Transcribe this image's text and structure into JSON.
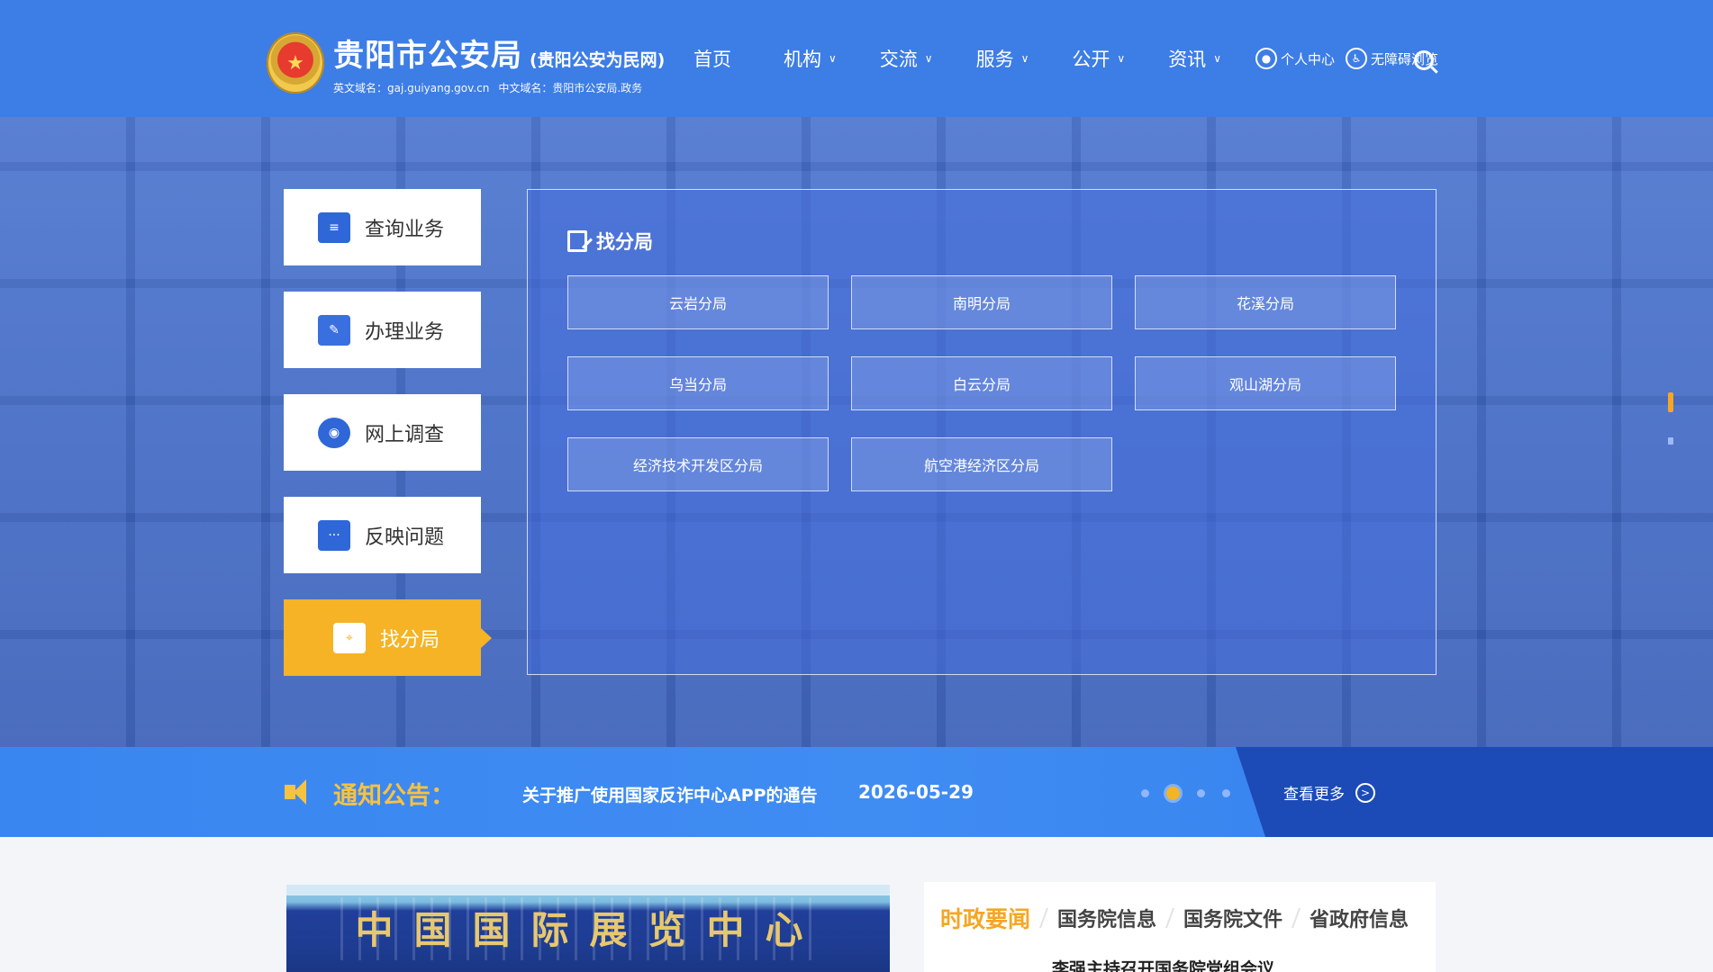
{
  "header": {
    "title": "贵阳市公安局",
    "subtitle": "(贵阳公安为民网)",
    "domain_en": "英文域名：gaj.guiyang.gov.cn",
    "domain_cn": "中文域名：贵阳市公安局.政务",
    "nav": [
      "首页",
      "机构",
      "交流",
      "服务",
      "公开",
      "资讯"
    ],
    "personal_center": "个人中心",
    "accessibility": "无障碍浏览"
  },
  "side_menu": [
    "查询业务",
    "办理业务",
    "网上调查",
    "反映问题",
    "找分局"
  ],
  "panel": {
    "title": "找分局",
    "branches": [
      "云岩分局",
      "南明分局",
      "花溪分局",
      "乌当分局",
      "白云分局",
      "观山湖分局",
      "经济技术开发区分局",
      "航空港经济区分局"
    ]
  },
  "notice": {
    "label": "通知公告：",
    "text": "关于推广使用国家反诈中心APP的通告",
    "date": "2026-05-29",
    "more": "查看更多",
    "active_dot": 2,
    "dot_count": 4
  },
  "photo_sign": [
    "中",
    "国",
    "国",
    "际",
    "展",
    "览",
    "中",
    "心"
  ],
  "news": {
    "tabs": [
      "时政要闻",
      "国务院信息",
      "国务院文件",
      "省政府信息"
    ],
    "active_tab": 0,
    "first_headline": "李强主持召开国务院党组会议"
  },
  "colors": {
    "header_blue": "#3d7de6",
    "accent_orange": "#f5b325",
    "notice_yellow": "#f5c242",
    "notice_dark": "#1c4bb8"
  }
}
